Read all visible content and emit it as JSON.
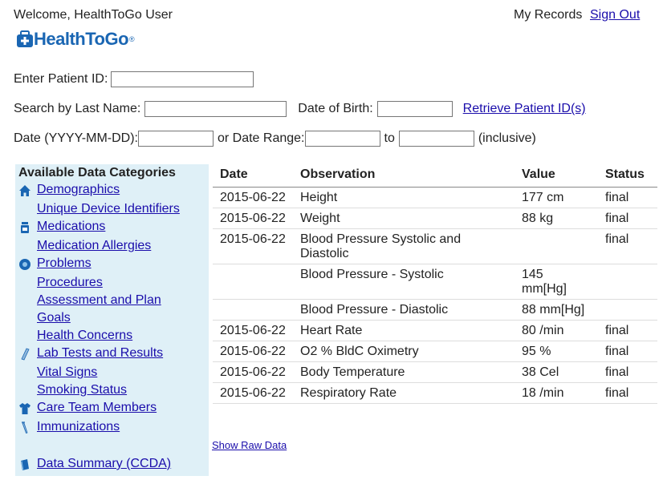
{
  "header": {
    "welcome": "Welcome, HealthToGo User",
    "my_records": "My Records",
    "sign_out": "Sign Out",
    "logo_text": "HealthToGo",
    "logo_mark": "®"
  },
  "form": {
    "patient_id_label": "Enter Patient ID:",
    "last_name_label": "Search by Last Name:",
    "dob_label": "Date of Birth:",
    "retrieve_link": "Retrieve Patient ID(s)",
    "date_label": "Date (YYYY-MM-DD):",
    "range_label": "or Date Range:",
    "to_label": "to",
    "inclusive_label": "(inclusive)"
  },
  "sidebar": {
    "title": "Available Data Categories",
    "items": [
      {
        "label": "Demographics",
        "icon": "home-icon"
      },
      {
        "label": "Unique Device Identifiers",
        "icon": ""
      },
      {
        "label": "Medications",
        "icon": "pill-bottle-icon"
      },
      {
        "label": "Medication Allergies",
        "icon": ""
      },
      {
        "label": "Problems",
        "icon": "problem-icon"
      },
      {
        "label": "Procedures",
        "icon": ""
      },
      {
        "label": "Assessment and Plan",
        "icon": ""
      },
      {
        "label": "Goals",
        "icon": ""
      },
      {
        "label": "Health Concerns",
        "icon": ""
      },
      {
        "label": "Lab Tests and Results",
        "icon": "test-tube-icon"
      },
      {
        "label": "Vital Signs",
        "icon": ""
      },
      {
        "label": "Smoking Status",
        "icon": ""
      },
      {
        "label": "Care Team Members",
        "icon": "shirt-icon"
      },
      {
        "label": "Immunizations",
        "icon": "syringe-icon"
      },
      {
        "label": "Data Summary (CCDA)",
        "icon": "book-icon"
      }
    ]
  },
  "table": {
    "headers": [
      "Date",
      "Observation",
      "Value",
      "Status"
    ],
    "rows": [
      {
        "date": "2015-06-22",
        "observation": "Height",
        "value": "177 cm",
        "status": "final"
      },
      {
        "date": "2015-06-22",
        "observation": "Weight",
        "value": "88 kg",
        "status": "final"
      },
      {
        "date": "2015-06-22",
        "observation": "Blood Pressure Systolic and Diastolic",
        "value": "",
        "status": "final"
      },
      {
        "date": "",
        "observation": "Blood Pressure - Systolic",
        "value": "145 mm[Hg]",
        "status": ""
      },
      {
        "date": "",
        "observation": "Blood Pressure - Diastolic",
        "value": "88 mm[Hg]",
        "status": ""
      },
      {
        "date": "2015-06-22",
        "observation": "Heart Rate",
        "value": "80 /min",
        "status": "final"
      },
      {
        "date": "2015-06-22",
        "observation": "O2 % BldC Oximetry",
        "value": "95 %",
        "status": "final"
      },
      {
        "date": "2015-06-22",
        "observation": "Body Temperature",
        "value": "38 Cel",
        "status": "final"
      },
      {
        "date": "2015-06-22",
        "observation": "Respiratory Rate",
        "value": "18 /min",
        "status": "final"
      }
    ]
  },
  "show_raw": "Show Raw Data",
  "colors": {
    "sidebar_bg": "#dff0f7",
    "link": "#1a0dab",
    "logo": "#1a66b3"
  }
}
